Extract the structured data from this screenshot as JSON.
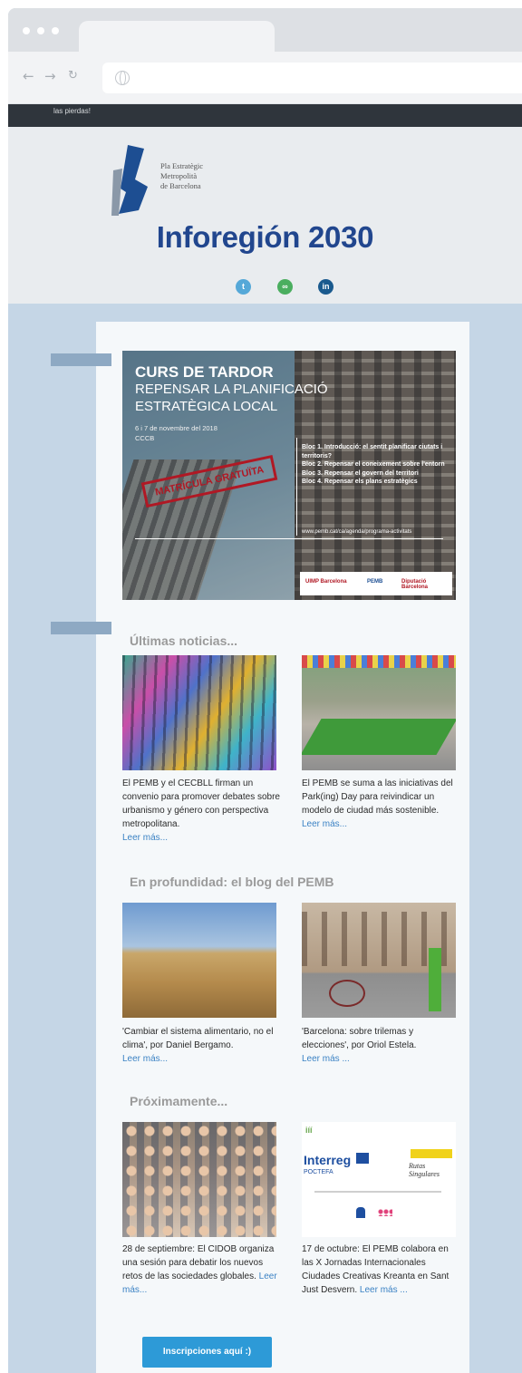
{
  "page": {
    "top_banner_text": "las pierdas!",
    "logo_text": [
      "Pla Estratègic",
      "Metropolità",
      "de Barcelona"
    ],
    "brand_title": "Inforegión 2030",
    "social": [
      "twitter-icon",
      "link-icon",
      "linkedin-icon"
    ]
  },
  "banner": {
    "title": "CURS DE TARDOR",
    "subtitle": "REPENSAR LA PLANIFICACIÓ ESTRATÈGICA LOCAL",
    "dates": "6 i 7 de novembre del 2018",
    "venue": "CCCB",
    "stamp": "MATRÍCULA GRATUÏTA",
    "blocs": [
      "Bloc 1. Introducció: el sentit planificar ciutats i territoris?",
      "Bloc 2. Repensar el coneixement sobre l'entorn",
      "Bloc 3. Repensar el govern del territori",
      "Bloc 4. Repensar els plans estratègics"
    ],
    "url": "www.pemb.cat/ca/agenda/programa-activitats",
    "partners": [
      "UIMP Barcelona",
      "PEMB",
      "Diputació Barcelona"
    ]
  },
  "sections": {
    "news_title": "Últimas noticias...",
    "blog_title": "En profundidad: el blog del PEMB",
    "upcoming_title": "Próximamente..."
  },
  "news": [
    {
      "text": "El PEMB y el CECBLL firman un convenio para promover debates sobre urbanismo y género con perspectiva metropolitana.",
      "more": "Leer más..."
    },
    {
      "text": "El PEMB se suma a las iniciativas del Park(ing) Day para reivindicar un modelo de ciudad más sostenible.",
      "more": "Leer más..."
    }
  ],
  "blog": [
    {
      "text": "'Cambiar el sistema alimentario, no el clima', por Daniel Bergamo.",
      "more": "Leer más..."
    },
    {
      "text": "'Barcelona: sobre trilemas y elecciones', por Oriol Estela.",
      "more": "Leer más ..."
    }
  ],
  "upcoming": [
    {
      "text": "28 de septiembre: El CIDOB organiza una sesión para debatir los nuevos retos de las sociedades globales.",
      "more": "Leer más..."
    },
    {
      "text": "17 de octubre: El PEMB colabora en las X Jornadas Internacionales Ciudades Creativas Kreanta en Sant Just Desvern.",
      "more": "Leer más ..."
    }
  ],
  "interreg": {
    "logo": "Interreg",
    "sub": "POCTEFA",
    "script": "Rutas Singulares"
  },
  "cta_label": "Inscripciones aquí :)"
}
